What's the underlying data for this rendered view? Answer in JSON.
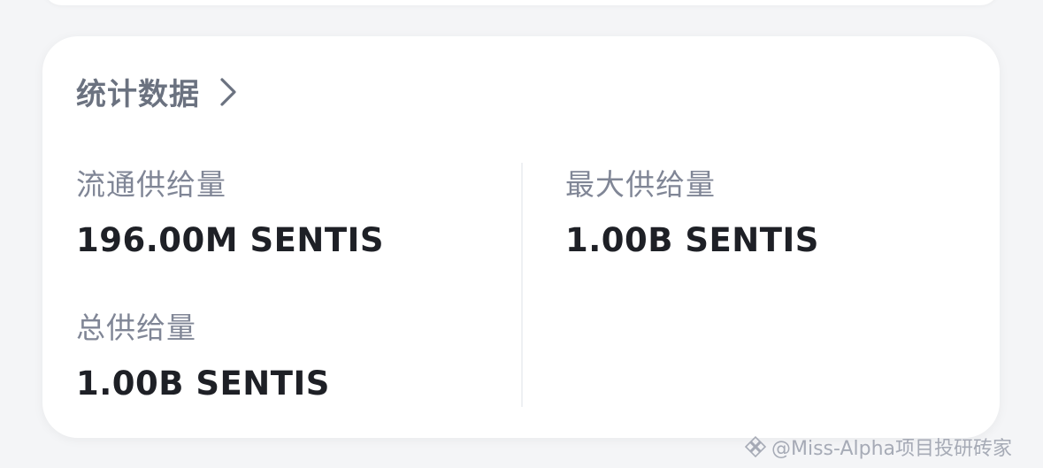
{
  "section": {
    "title": "统计数据"
  },
  "stats": {
    "circulating_supply": {
      "label": "流通供给量",
      "value": "196.00M SENTIS"
    },
    "max_supply": {
      "label": "最大供给量",
      "value": "1.00B SENTIS"
    },
    "total_supply": {
      "label": "总供给量",
      "value": "1.00B SENTIS"
    }
  },
  "watermark": {
    "text": "@Miss-Alpha项目投研砖家"
  },
  "colors": {
    "label_gray": "#808696",
    "value_dark": "#1e2026",
    "title_gray": "#6b7280",
    "background": "#f4f5f7"
  },
  "icons": {
    "header_chevron": "chevron-right-icon",
    "watermark_logo": "binance-square-icon"
  }
}
